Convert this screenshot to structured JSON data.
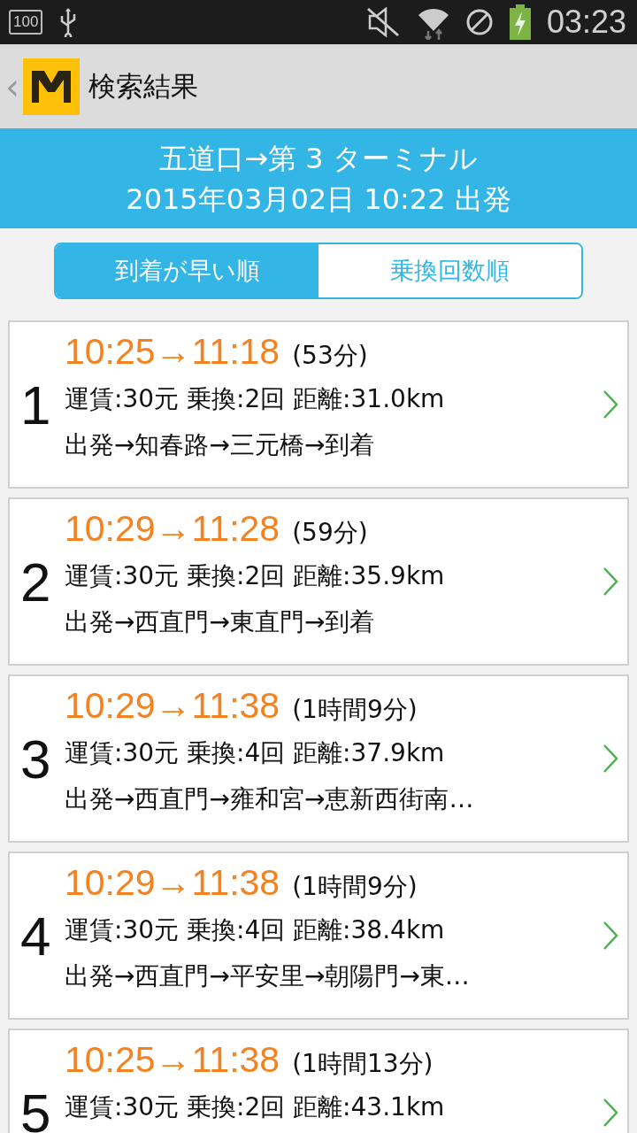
{
  "status_bar": {
    "battery_level_text": "100",
    "time": "03:23"
  },
  "app_bar": {
    "back": "‹",
    "title": "検索結果"
  },
  "route_header": {
    "route": "五道口→第 3 ターミナル",
    "departure": "2015年03月02日 10:22 出発"
  },
  "sort_tabs": [
    {
      "label": "到着が早い順",
      "selected": true
    },
    {
      "label": "乗換回数順",
      "selected": false
    }
  ],
  "results": [
    {
      "number": "1",
      "times": "10:25→11:18",
      "duration": "(53分)",
      "summary": "運賃:30元 乗換:2回 距離:31.0km",
      "stops": "出発→知春路→三元橋→到着"
    },
    {
      "number": "2",
      "times": "10:29→11:28",
      "duration": "(59分)",
      "summary": "運賃:30元 乗換:2回 距離:35.9km",
      "stops": "出発→西直門→東直門→到着"
    },
    {
      "number": "3",
      "times": "10:29→11:38",
      "duration": "(1時間9分)",
      "summary": "運賃:30元 乗換:4回 距離:37.9km",
      "stops": "出発→西直門→雍和宮→恵新西街南…"
    },
    {
      "number": "4",
      "times": "10:29→11:38",
      "duration": "(1時間9分)",
      "summary": "運賃:30元 乗換:4回 距離:38.4km",
      "stops": "出発→西直門→平安里→朝陽門→東…"
    },
    {
      "number": "5",
      "times": "10:25→11:38",
      "duration": "(1時間13分)",
      "summary": "運賃:30元 乗換:2回 距離:43.1km"
    }
  ]
}
